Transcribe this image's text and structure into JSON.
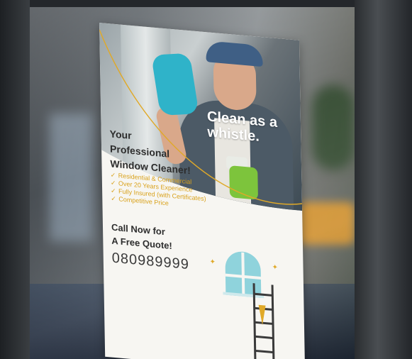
{
  "poster": {
    "slogan": "Clean as a whistle.",
    "headline_line1": "Your",
    "headline_line2": "Professional",
    "headline_line3": "Window Cleaner!",
    "features": [
      "Residential & Commercial",
      "Over 20 Years Experience",
      "Fully Insured (with Certificates)",
      "Competitive Price"
    ],
    "cta_line1": "Call Now for",
    "cta_line2": "A Free Quote!",
    "phone": "080989999"
  },
  "colors": {
    "accent": "#d9a21c",
    "teal": "#8fd3dc",
    "text": "#2d2d2d",
    "poster_bg": "#f7f6f2"
  },
  "icons": {
    "check": "check-icon",
    "window": "arched-window-icon",
    "ladder": "ladder-icon",
    "sparkle": "sparkle-icon"
  }
}
